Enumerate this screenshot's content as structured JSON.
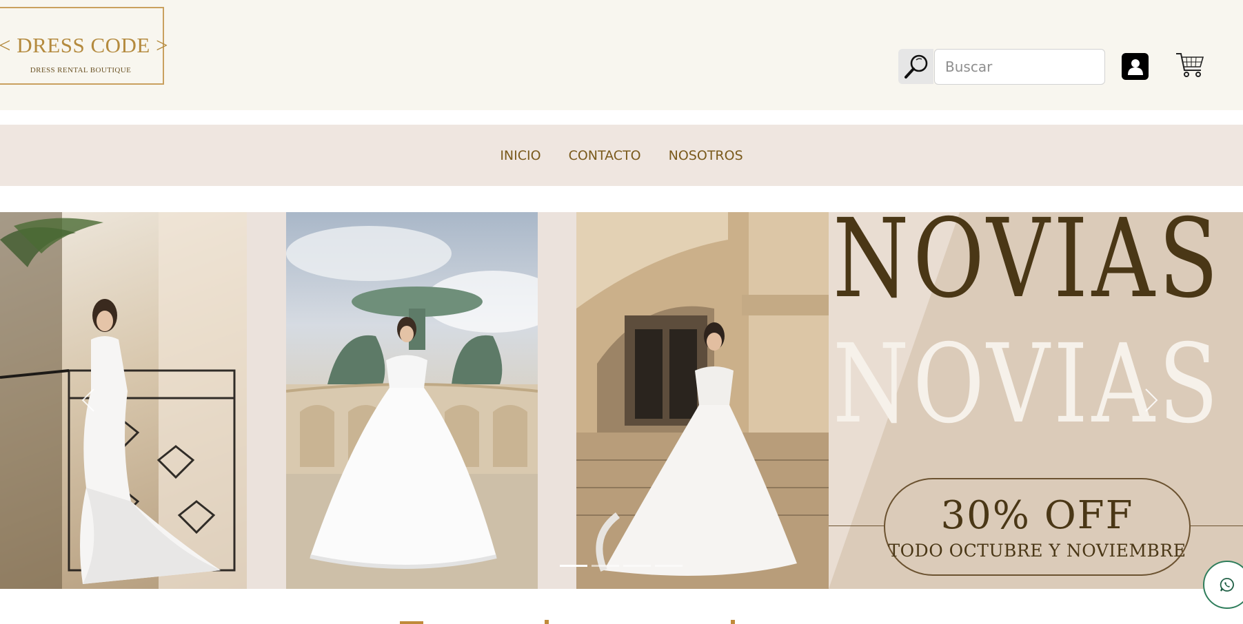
{
  "header": {
    "logo": {
      "title": "< DRESS CODE >",
      "subtitle": "DRESS RENTAL BOUTIQUE"
    },
    "search": {
      "placeholder": "Buscar",
      "value": "",
      "icon": "magnifier-icon"
    },
    "user_icon": "user-icon",
    "cart_icon": "cart-icon"
  },
  "nav": {
    "items": [
      {
        "label": "INICIO"
      },
      {
        "label": "CONTACTO"
      },
      {
        "label": "NOSOTROS"
      }
    ]
  },
  "carousel": {
    "banner": {
      "line1": "NOVIAS",
      "line2": "NOVIAS",
      "discount": "30% OFF",
      "period": "TODO OCTUBRE Y NOVIEMBRE"
    },
    "indicator_count": 4,
    "active_indicator": 1
  },
  "colors": {
    "header_bg": "#f8f6ef",
    "nav_bg": "#efe6e0",
    "accent_gold": "#c9a05e",
    "nav_text": "#7a5a1c",
    "banner_text": "#4a3716"
  },
  "section": {
    "title": ""
  }
}
